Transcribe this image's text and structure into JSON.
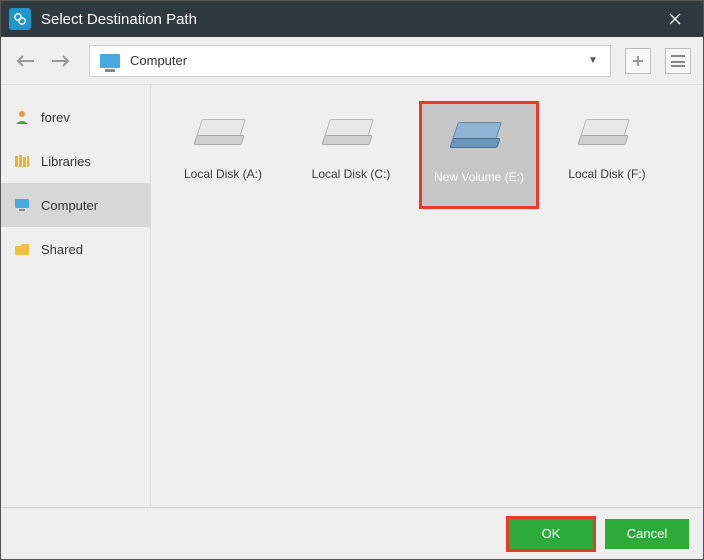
{
  "titlebar": {
    "title": "Select Destination Path"
  },
  "address": {
    "location": "Computer"
  },
  "sidebar": {
    "items": [
      {
        "label": "forev"
      },
      {
        "label": "Libraries"
      },
      {
        "label": "Computer"
      },
      {
        "label": "Shared"
      }
    ]
  },
  "drives": [
    {
      "label": "Local Disk (A:)"
    },
    {
      "label": "Local Disk (C:)"
    },
    {
      "label": "New Volume (E:)"
    },
    {
      "label": "Local Disk (F:)"
    }
  ],
  "footer": {
    "ok": "OK",
    "cancel": "Cancel"
  }
}
